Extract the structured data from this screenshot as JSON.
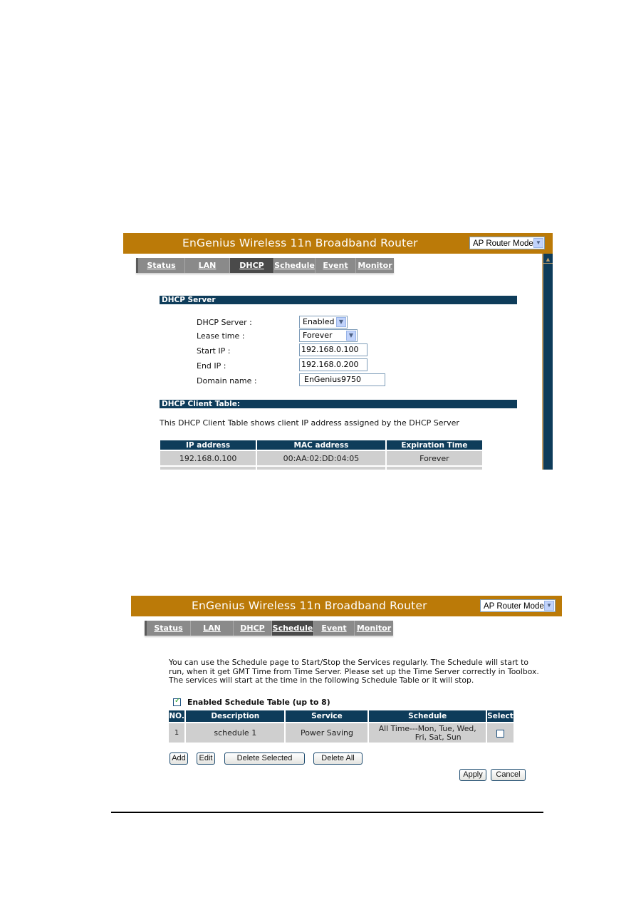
{
  "screenshots": [
    {
      "header": {
        "title": "EnGenius Wireless 11n Broadband Router",
        "mode_select": "AP Router Mode",
        "mode_icon": "chevron-down-icon"
      },
      "tabs": [
        {
          "label": "Status",
          "active": false
        },
        {
          "label": "LAN",
          "active": false
        },
        {
          "label": "DHCP",
          "active": true
        },
        {
          "label": "Schedule",
          "active": false
        },
        {
          "label": "Event Log",
          "active": false
        },
        {
          "label": "Monitor",
          "active": false
        }
      ],
      "dhcp_server": {
        "section_title": "DHCP Server",
        "fields": [
          {
            "label": "DHCP Server :",
            "value": "Enabled",
            "type": "select"
          },
          {
            "label": "Lease time :",
            "value": "Forever",
            "type": "select"
          },
          {
            "label": "Start IP :",
            "value": "192.168.0.100",
            "type": "text"
          },
          {
            "label": "End IP :",
            "value": "192.168.0.200",
            "type": "text"
          },
          {
            "label": "Domain name :",
            "value": "EnGenius9750",
            "type": "text"
          }
        ]
      },
      "client_table": {
        "section_title": "DHCP Client Table:",
        "description": "This DHCP Client Table shows client IP address assigned by the DHCP Server",
        "columns": [
          "IP address",
          "MAC address",
          "Expiration Time"
        ],
        "rows": [
          [
            "192.168.0.100",
            "00:AA:02:DD:04:05",
            "Forever"
          ]
        ]
      }
    },
    {
      "header": {
        "title": "EnGenius Wireless 11n Broadband Router",
        "mode_select": "AP Router Mode",
        "mode_icon": "chevron-down-icon"
      },
      "tabs": [
        {
          "label": "Status",
          "active": false
        },
        {
          "label": "LAN",
          "active": false
        },
        {
          "label": "DHCP",
          "active": false
        },
        {
          "label": "Schedule",
          "active": true
        },
        {
          "label": "Event Log",
          "active": false
        },
        {
          "label": "Monitor",
          "active": false
        }
      ],
      "schedule": {
        "description_lines": [
          "You can use the Schedule page to Start/Stop the Services regularly. The Schedule will start to",
          "run, when it get GMT Time from Time Server. Please set up the Time Server correctly in Toolbox.",
          "The services will start at the time in the following Schedule Table or it will stop."
        ],
        "enable_label": "Enabled Schedule Table (up to 8)",
        "enable_checked": true,
        "columns": [
          "NO.",
          "Description",
          "Service",
          "Schedule",
          "Select"
        ],
        "rows": [
          {
            "no": "1",
            "description": "schedule 1",
            "service": "Power Saving",
            "schedule_line1": "All Time---Mon, Tue, Wed,",
            "schedule_line2": "Fri, Sat, Sun",
            "selected": false
          }
        ],
        "buttons": {
          "add": "Add",
          "edit": "Edit",
          "delete_selected": "Delete Selected",
          "delete_all": "Delete All",
          "apply": "Apply",
          "cancel": "Cancel"
        }
      }
    }
  ]
}
